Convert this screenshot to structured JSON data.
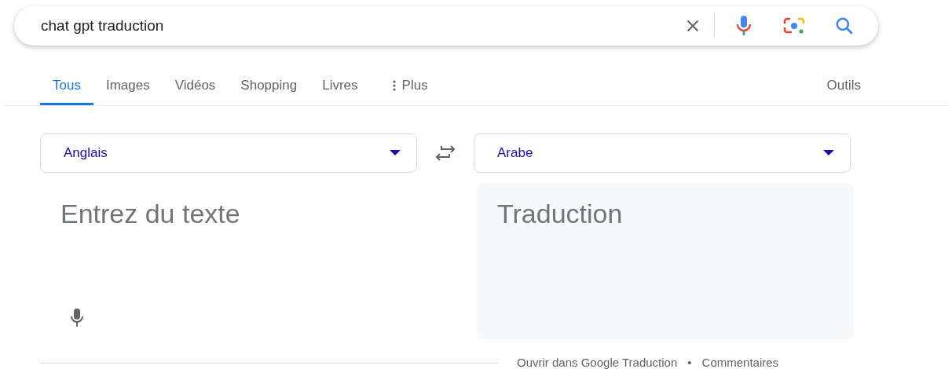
{
  "search": {
    "value": "chat gpt traduction"
  },
  "tabs": [
    {
      "label": "Tous",
      "selected": true
    },
    {
      "label": "Images",
      "selected": false
    },
    {
      "label": "Vidéos",
      "selected": false
    },
    {
      "label": "Shopping",
      "selected": false
    },
    {
      "label": "Livres",
      "selected": false
    },
    {
      "label": "Plus",
      "selected": false,
      "kind": "more"
    }
  ],
  "tools": "Outils",
  "translator": {
    "source_language": "Anglais",
    "target_language": "Arabe",
    "input": {
      "placeholder": "Entrez du texte"
    },
    "output": {
      "placeholder": "Traduction"
    }
  },
  "footer": {
    "links": [
      "Ouvrir dans Google Traduction",
      "Commentaires"
    ],
    "separator": "•"
  }
}
